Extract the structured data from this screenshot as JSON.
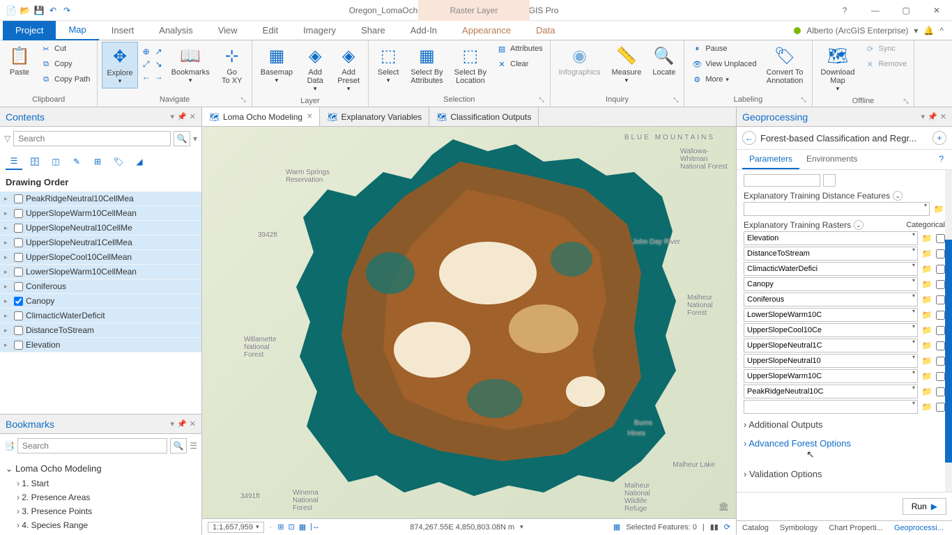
{
  "titlebar": {
    "title": "Oregon_LomaOcho - Loma Ocho Modeling - ArcGIS Pro",
    "context_tab": "Raster Layer"
  },
  "user": {
    "name": "Alberto (ArcGIS Enterprise)"
  },
  "ribbon_tabs": {
    "project": "Project",
    "map": "Map",
    "insert": "Insert",
    "analysis": "Analysis",
    "view": "View",
    "edit": "Edit",
    "imagery": "Imagery",
    "share": "Share",
    "addin": "Add-In",
    "appearance": "Appearance",
    "data": "Data"
  },
  "ribbon": {
    "clipboard": {
      "paste": "Paste",
      "cut": "Cut",
      "copy": "Copy",
      "copy_path": "Copy Path",
      "label": "Clipboard"
    },
    "navigate": {
      "explore": "Explore",
      "bookmarks": "Bookmarks",
      "go_to_xy": "Go\nTo XY",
      "label": "Navigate"
    },
    "layer": {
      "basemap": "Basemap",
      "add_data": "Add\nData",
      "add_preset": "Add\nPreset",
      "label": "Layer"
    },
    "selection": {
      "select": "Select",
      "select_by_attr": "Select By\nAttributes",
      "select_by_loc": "Select By\nLocation",
      "attributes": "Attributes",
      "clear": "Clear",
      "label": "Selection"
    },
    "inquiry": {
      "infographics": "Infographics",
      "measure": "Measure",
      "locate": "Locate",
      "label": "Inquiry"
    },
    "labeling": {
      "pause": "Pause",
      "view_unplaced": "View Unplaced",
      "more": "More",
      "convert": "Convert To\nAnnotation",
      "label": "Labeling"
    },
    "offline": {
      "download": "Download\nMap",
      "sync": "Sync",
      "remove": "Remove",
      "label": "Offline"
    }
  },
  "contents": {
    "title": "Contents",
    "search_placeholder": "Search",
    "drawing_order": "Drawing Order",
    "layers": [
      {
        "name": "PeakRidgeNeutral10CellMea",
        "checked": false
      },
      {
        "name": "UpperSlopeWarm10CellMean",
        "checked": false
      },
      {
        "name": "UpperSlopeNeutral10CellMe",
        "checked": false
      },
      {
        "name": "UpperSlopeNeutral1CellMea",
        "checked": false
      },
      {
        "name": "UpperSlopeCool10CellMean",
        "checked": false
      },
      {
        "name": "LowerSlopeWarm10CellMean",
        "checked": false
      },
      {
        "name": "Coniferous",
        "checked": false
      },
      {
        "name": "Canopy",
        "checked": true
      },
      {
        "name": "ClimacticWaterDeficit",
        "checked": false
      },
      {
        "name": "DistanceToStream",
        "checked": false
      },
      {
        "name": "Elevation",
        "checked": false
      }
    ]
  },
  "bookmarks": {
    "title": "Bookmarks",
    "search_placeholder": "Search",
    "group": "Loma Ocho Modeling",
    "items": [
      "1. Start",
      "2. Presence Areas",
      "3. Presence Points",
      "4. Species Range"
    ]
  },
  "map_tabs": [
    {
      "label": "Loma Ocho Modeling",
      "active": true,
      "closeable": true
    },
    {
      "label": "Explanatory Variables",
      "active": false,
      "closeable": false
    },
    {
      "label": "Classification Outputs",
      "active": false,
      "closeable": false
    }
  ],
  "map_labels": {
    "blue_mountains": "BLUE MOUNTAINS",
    "wallowa": "Wallowa-Whitman National Forest",
    "johnday": "John Day River",
    "malheur_forest": "Malheur National Forest",
    "malheur_lake": "Malheur Lake",
    "malheur_refuge": "Malheur National Wildlife Refuge",
    "burns": "Burns",
    "hines": "Hines",
    "willamette": "Willamette National Forest",
    "winema": "Winema National Forest",
    "warm_springs": "Warm Springs Reservation",
    "elev1": "3942ft",
    "elev2": "3491ft"
  },
  "statusbar": {
    "scale": "1:1,657,959",
    "coords": "874,267.55E 4,850,803.08N m",
    "selected": "Selected Features: 0"
  },
  "gp": {
    "title": "Geoprocessing",
    "tool_name": "Forest-based Classification and Regr...",
    "tabs": {
      "parameters": "Parameters",
      "environments": "Environments"
    },
    "dist_features_label": "Explanatory Training Distance Features",
    "rasters_label": "Explanatory Training Rasters",
    "categorical_label": "Categorical",
    "rasters": [
      "Elevation",
      "DistanceToStream",
      "ClimacticWaterDefici",
      "Canopy",
      "Coniferous",
      "LowerSlopeWarm10C",
      "UpperSlopeCool10Ce",
      "UpperSlopeNeutral1C",
      "UpperSlopeNeutral10",
      "UpperSlopeWarm10C",
      "PeakRidgeNeutral10C",
      ""
    ],
    "sections": {
      "additional": "Additional Outputs",
      "advanced": "Advanced Forest Options",
      "validation": "Validation Options"
    },
    "run": "Run",
    "bottom_tabs": [
      "Catalog",
      "Symbology",
      "Chart Properti...",
      "Geoprocessi..."
    ]
  }
}
